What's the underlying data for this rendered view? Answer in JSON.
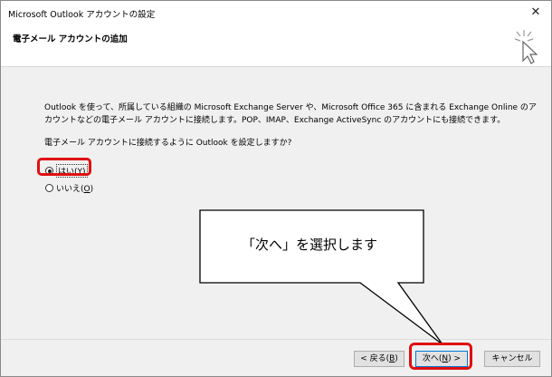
{
  "window": {
    "title": "Microsoft Outlook アカウントの設定",
    "close_glyph": "✕"
  },
  "header": {
    "title": "電子メール アカウントの追加",
    "icon": "cursor-sparkle-icon"
  },
  "content": {
    "description": "Outlook を使って、所属している組織の Microsoft Exchange Server や、Microsoft Office 365 に含まれる Exchange Online のアカウントなどの電子メール アカウントに接続します。POP、IMAP、Exchange ActiveSync のアカウントにも接続できます。",
    "question": "電子メール アカウントに接続するように Outlook を設定しますか?",
    "options": [
      {
        "label": "はい(",
        "accel": "Y",
        "suffix": ")",
        "selected": true
      },
      {
        "label": "いいえ(",
        "accel": "O",
        "suffix": ")",
        "selected": false
      }
    ]
  },
  "callout": {
    "text": "「次へ」を選択します"
  },
  "footer": {
    "back": {
      "label": "< 戻る(",
      "accel": "B",
      "suffix": ")"
    },
    "next": {
      "label": "次へ(",
      "accel": "N",
      "suffix": ") >"
    },
    "cancel": {
      "label": "キャンセル"
    }
  },
  "colors": {
    "highlight_red": "#e01010",
    "dialog_bg": "#f0f0f0",
    "default_button_border": "#0078d7"
  }
}
